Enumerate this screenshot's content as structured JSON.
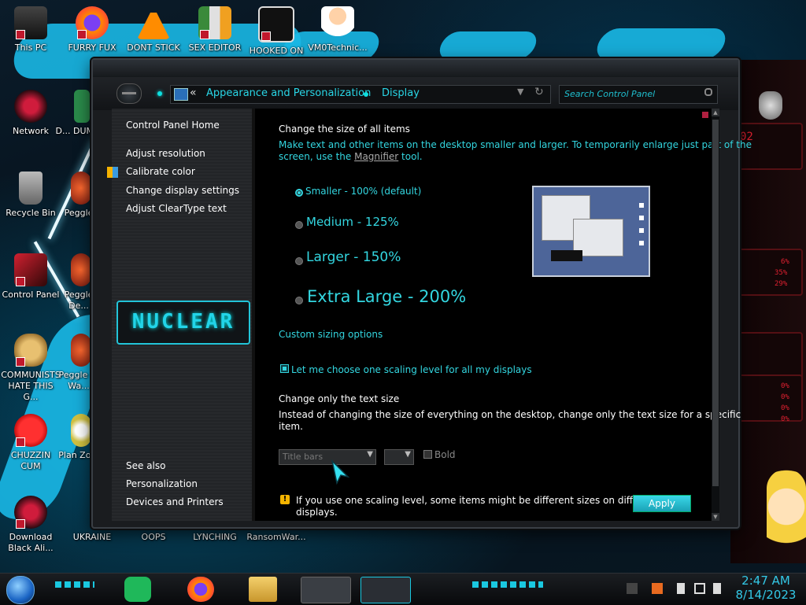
{
  "desktop": {
    "icons": [
      {
        "label": "This PC"
      },
      {
        "label": "FURRY FUX"
      },
      {
        "label": "DONT STICK"
      },
      {
        "label": "SEX EDITOR"
      },
      {
        "label": "HOOKED ON"
      },
      {
        "label": "VM0Technic..."
      },
      {
        "label": "Network"
      },
      {
        "label": "D... DUM..."
      },
      {
        "label": "Recycle Bin"
      },
      {
        "label": "Peggle"
      },
      {
        "label": "Control Panel"
      },
      {
        "label": "Peggle De..."
      },
      {
        "label": "COMMUNISTS HATE THIS G..."
      },
      {
        "label": "Peggle of Wa..."
      },
      {
        "label": "CHUZZIN CUM"
      },
      {
        "label": "Plan Zo..."
      },
      {
        "label": "Download Black Ali..."
      },
      {
        "label": "UKRAINE"
      },
      {
        "label": "OOPS"
      },
      {
        "label": "LYNCHING"
      },
      {
        "label": "RansomWar..."
      }
    ]
  },
  "window": {
    "address": {
      "chevron": "«",
      "crumb1": "Appearance and Personalization",
      "crumb2": "Display"
    },
    "search_placeholder": "Search Control Panel",
    "sidebar": {
      "home": "Control Panel Home",
      "links": [
        "Adjust resolution",
        "Calibrate color",
        "Change display settings",
        "Adjust ClearType text"
      ],
      "logo_text": "NUCLEAR",
      "see_also": "See also",
      "see_also_links": [
        "Personalization",
        "Devices and Printers"
      ]
    },
    "content": {
      "heading": "Change the size of all items",
      "desc_line1": "Make text and other items on the desktop smaller and larger. To temporarily enlarge just part of the",
      "desc_line2_pre": "screen, use the ",
      "desc_link": "Magnifier",
      "desc_line2_post": " tool.",
      "options": [
        {
          "label": "Smaller - 100% (default)",
          "selected": true
        },
        {
          "label": "Medium - 125%",
          "selected": false
        },
        {
          "label": "Larger - 150%",
          "selected": false
        },
        {
          "label": "Extra Large - 200%",
          "selected": false
        }
      ],
      "custom_sizing": "Custom sizing options",
      "checkbox_label": "Let me choose one scaling level for all my displays",
      "text_heading": "Change only the text size",
      "text_desc1": "Instead of changing the size of everything on the desktop, change only the text size for a specific",
      "text_desc2": "item.",
      "item_dropdown": "Title bars",
      "bold_label": "Bold",
      "warning_line1": "If you use one scaling level, some items might be different sizes on different",
      "warning_line2": "displays.",
      "apply_label": "Apply"
    }
  },
  "right_panel": {
    "readouts": [
      "02",
      "6%",
      "35%",
      "29%",
      "0%",
      "0%",
      "0%",
      "0%"
    ]
  },
  "taskbar": {
    "time": "2:47 AM",
    "date": "8/14/2023"
  },
  "colors": {
    "accent": "#33d6e0",
    "window_bg": "#000000",
    "sidebar_bg": "#252729"
  }
}
